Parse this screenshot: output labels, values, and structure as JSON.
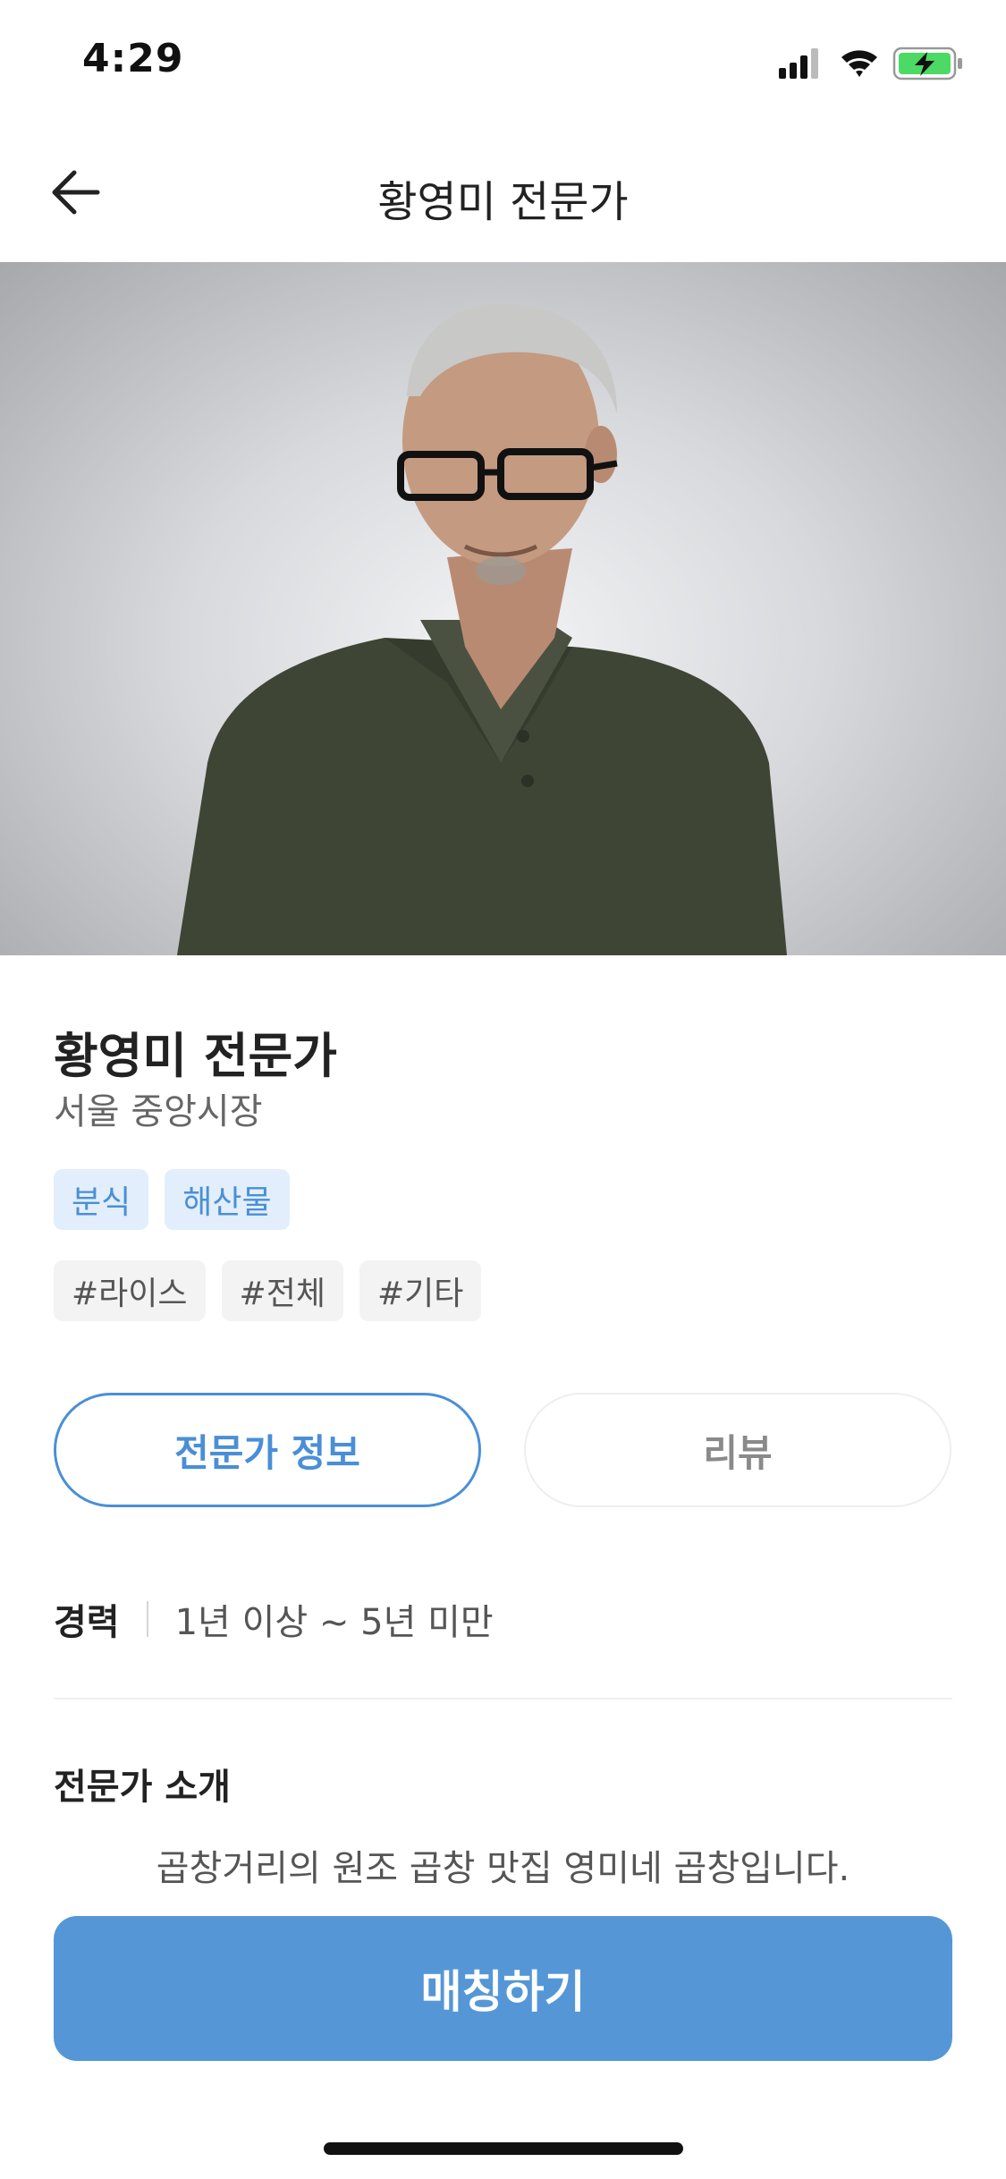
{
  "status_bar": {
    "time": "4:29",
    "icons": [
      "signal-icon",
      "wifi-icon",
      "battery-charging-icon"
    ],
    "battery_color": "#4cd964"
  },
  "nav": {
    "back_icon": "arrow-left-icon",
    "title": "황영미 전문가"
  },
  "profile": {
    "photo_description_icon": "expert-portrait-photo",
    "name": "황영미 전문가",
    "location": "서울 중앙시장",
    "categories": [
      "분식",
      "해산물"
    ],
    "hashtags": [
      "#라이스",
      "#전체",
      "#기타"
    ]
  },
  "tabs": {
    "expert_info": "전문가 정보",
    "reviews": "리뷰"
  },
  "career": {
    "label": "경력",
    "value": "1년 이상 ~ 5년 미만"
  },
  "intro": {
    "title": "전문가 소개",
    "text": "곱창거리의 원조 곱창 맛집 영미네 곱창입니다."
  },
  "cta": {
    "label": "매칭하기"
  },
  "colors": {
    "accent": "#4a8fd6",
    "button": "#5597d6",
    "category_bg": "#e2eefb",
    "hashtag_bg": "#f3f3f3"
  }
}
